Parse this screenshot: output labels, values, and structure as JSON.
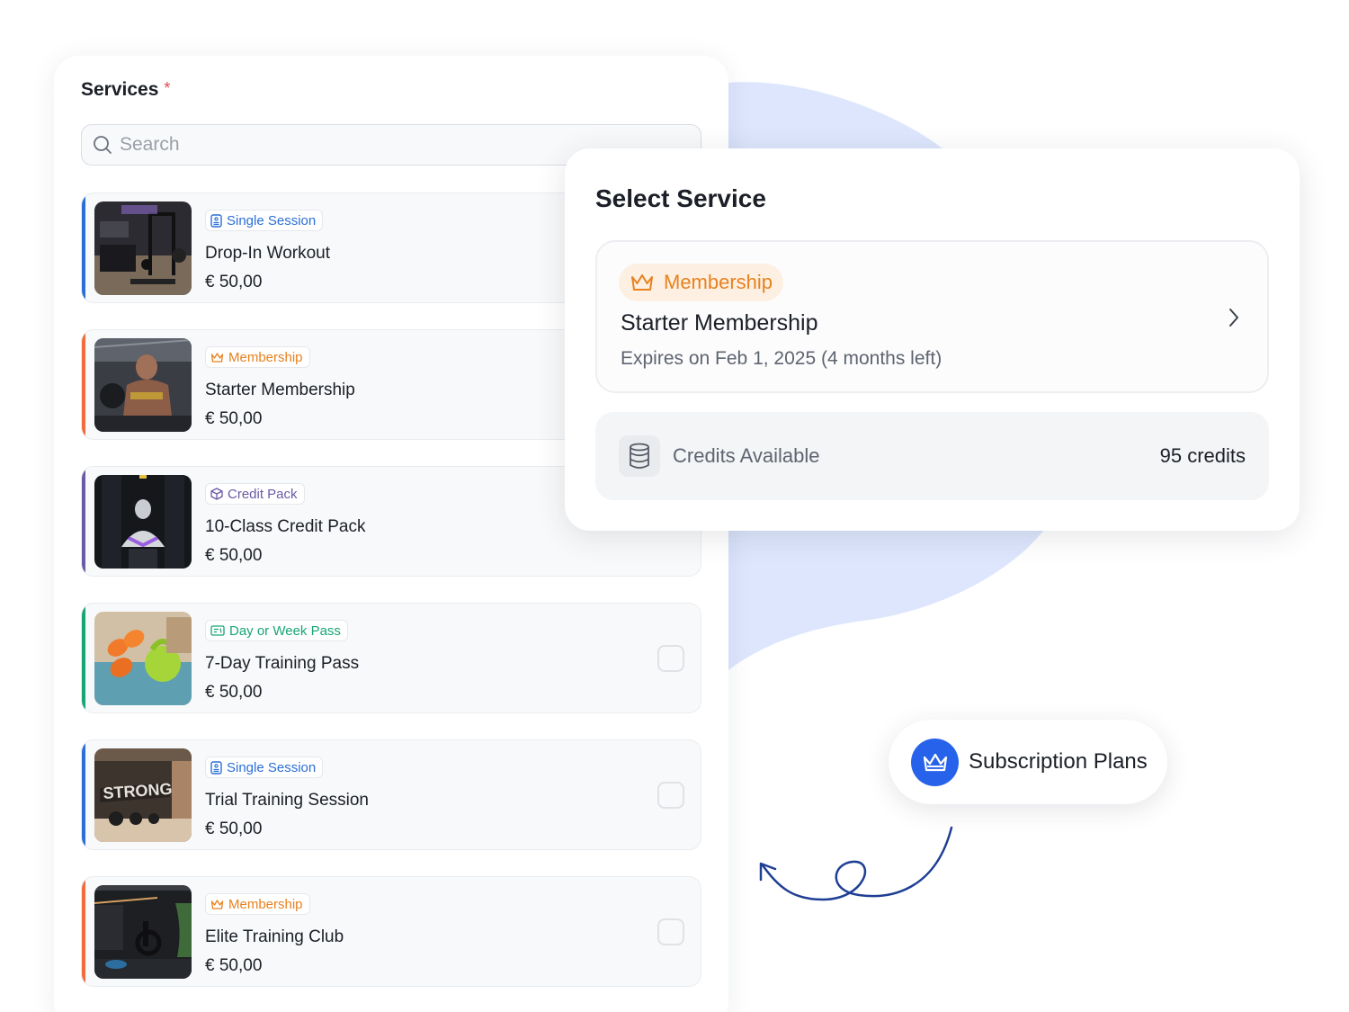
{
  "services": {
    "title": "Services",
    "required_mark": "*",
    "search": {
      "placeholder": "Search",
      "value": ""
    },
    "items": [
      {
        "type_label": "Single Session",
        "type_icon": "id-card-icon",
        "type_color": "#2b6fd6",
        "accent": "#2b6fd6",
        "name": "Drop-In Workout",
        "price": "€ 50,00",
        "image": "gym-equipment-photo"
      },
      {
        "type_label": "Membership",
        "type_icon": "crown-icon",
        "type_color": "#e8811e",
        "accent": "#f26b3a",
        "name": "Starter Membership",
        "price": "€ 50,00",
        "image": "athlete-photo"
      },
      {
        "type_label": "Credit Pack",
        "type_icon": "box-icon",
        "type_color": "#6b5aa6",
        "accent": "#6b5aa6",
        "name": "10-Class Credit Pack",
        "price": "€ 50,00",
        "image": "mannequin-photo"
      },
      {
        "type_label": "Day or Week Pass",
        "type_icon": "ticket-icon",
        "type_color": "#17a673",
        "accent": "#17a673",
        "name": "7-Day Training Pass",
        "price": "€ 50,00",
        "image": "dumbbells-photo"
      },
      {
        "type_label": "Single Session",
        "type_icon": "id-card-icon",
        "type_color": "#2b6fd6",
        "accent": "#2b6fd6",
        "name": "Trial Training Session",
        "price": "€ 50,00",
        "image": "stay-strong-wall-photo"
      },
      {
        "type_label": "Membership",
        "type_icon": "crown-icon",
        "type_color": "#e8811e",
        "accent": "#f26b3a",
        "name": "Elite Training Club",
        "price": "€ 50,00",
        "image": "dark-gym-photo"
      }
    ]
  },
  "select_service": {
    "title": "Select Service",
    "plan": {
      "badge_label": "Membership",
      "name": "Starter Membership",
      "expiry": "Expires on Feb 1, 2025 (4 months left)"
    },
    "credits": {
      "label": "Credits Available",
      "value": "95 credits"
    }
  },
  "subscription_pill": {
    "label": "Subscription Plans"
  },
  "colors": {
    "brand_blue": "#2762ea",
    "membership_orange": "#e8811e",
    "blob": "#dbe4fb"
  }
}
